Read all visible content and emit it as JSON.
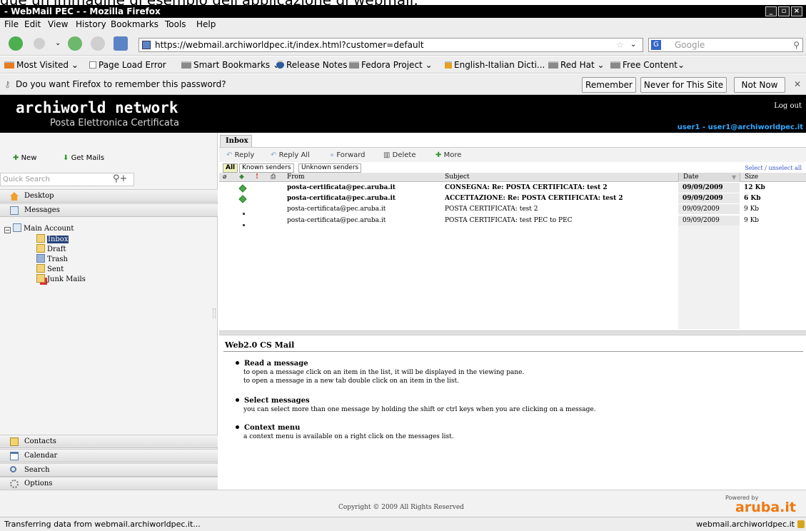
{
  "caption": "gue un'immagine di esempio dell'applicazione di webmail:",
  "window": {
    "title": "- WebMail PEC - - Mozilla Firefox"
  },
  "menubar": [
    "File",
    "Edit",
    "View",
    "History",
    "Bookmarks",
    "Tools",
    "Help"
  ],
  "navbar": {
    "url": "https://webmail.archiworldpec.it/index.html?customer=default",
    "search_placeholder": "Google"
  },
  "bookmarks": [
    "Most Visited",
    "Page Load Error",
    "Smart Bookmarks",
    "Release Notes",
    "Fedora Project",
    "English-Italian Dicti...",
    "Red Hat",
    "Free Content"
  ],
  "password_bar": {
    "message": "Do you want Firefox to remember this password?",
    "remember": "Remember",
    "never": "Never for This Site",
    "not_now": "Not Now"
  },
  "header": {
    "logo": "archiworld network",
    "subtitle": "Posta Elettronica Certificata",
    "logout": "Log out",
    "user": "user1 - user1@archiworldpec.it"
  },
  "sidebar": {
    "new_label": "New",
    "get_mails_label": "Get Mails",
    "quick_search_placeholder": "Quick Search",
    "desktop": "Desktop",
    "messages": "Messages",
    "account": "Main Account",
    "folders": [
      "Inbox",
      "Draft",
      "Trash",
      "Sent",
      "Junk Mails"
    ],
    "bottom": [
      "Contacts",
      "Calendar",
      "Search",
      "Options"
    ]
  },
  "main": {
    "tab": "Inbox",
    "toolbar": [
      "Reply",
      "Reply All",
      "Forward",
      "Delete",
      "More"
    ],
    "filters": [
      "All",
      "Known senders",
      "Unknown senders"
    ],
    "select_unselect": "Select / unselect all",
    "columns": {
      "from": "From",
      "subject": "Subject",
      "date": "Date",
      "size": "Size"
    },
    "messages": [
      {
        "from": "posta-certificata@pec.aruba.it",
        "subject": "CONSEGNA: Re: POSTA CERTIFICATA: test 2",
        "date": "09/09/2009",
        "size": "12 Kb",
        "unread": true
      },
      {
        "from": "posta-certificata@pec.aruba.it",
        "subject": "ACCETTAZIONE: Re: POSTA CERTIFICATA: test 2",
        "date": "09/09/2009",
        "size": "6 Kb",
        "unread": true
      },
      {
        "from": "posta-certificata@pec.aruba.it",
        "subject": "POSTA CERTIFICATA: test 2",
        "date": "09/09/2009",
        "size": "9 Kb",
        "unread": false
      },
      {
        "from": "posta-certificata@pec.aruba.it",
        "subject": "POSTA CERTIFICATA: test PEC to PEC",
        "date": "09/09/2009",
        "size": "9 Kb",
        "unread": false
      }
    ]
  },
  "preview": {
    "title": "Web2.0 CS Mail",
    "tips": [
      {
        "heading": "Read a message",
        "lines": [
          "to open a message click on an item in the list, it will be displayed in the viewing pane.",
          "to open a message in a new tab double click on an item in the list."
        ]
      },
      {
        "heading": "Select messages",
        "lines": [
          "you can select more than one message by holding the shift or ctrl keys when you are clicking on a message."
        ]
      },
      {
        "heading": "Context menu",
        "lines": [
          "a context menu is available on a right click on the messages list."
        ]
      }
    ]
  },
  "footer": {
    "copyright": "Copyright © 2009 All Rights Reserved",
    "powered": "Powered by",
    "brand": "aruba.it"
  },
  "status": {
    "left": "Transferring data from webmail.archiworldpec.it...",
    "right": "webmail.archiworldpec.it"
  }
}
